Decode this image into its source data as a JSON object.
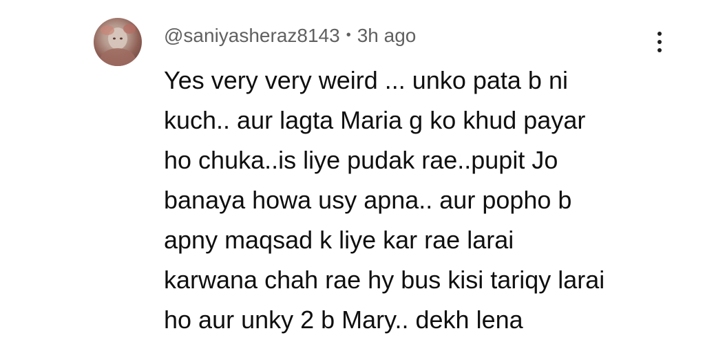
{
  "comment": {
    "author_handle": "@saniyasheraz8143",
    "separator": "•",
    "timestamp": "3h ago",
    "avatar_icon": "user-avatar",
    "menu_icon": "more-vertical-icon",
    "text_lines": [
      "Yes very very weird ... unko pata b ni",
      "kuch.. aur lagta Maria g ko khud payar",
      "ho chuka..is liye pudak rae..pupit Jo",
      "banaya howa usy apna.. aur popho b",
      "apny maqsad k liye kar rae larai",
      "karwana chah rae hy bus kisi tariqy larai",
      "ho aur unky 2 b Mary.. dekh lena"
    ]
  },
  "colors": {
    "meta_text": "#606060",
    "body_text": "#0f0f0f",
    "background": "#ffffff"
  }
}
